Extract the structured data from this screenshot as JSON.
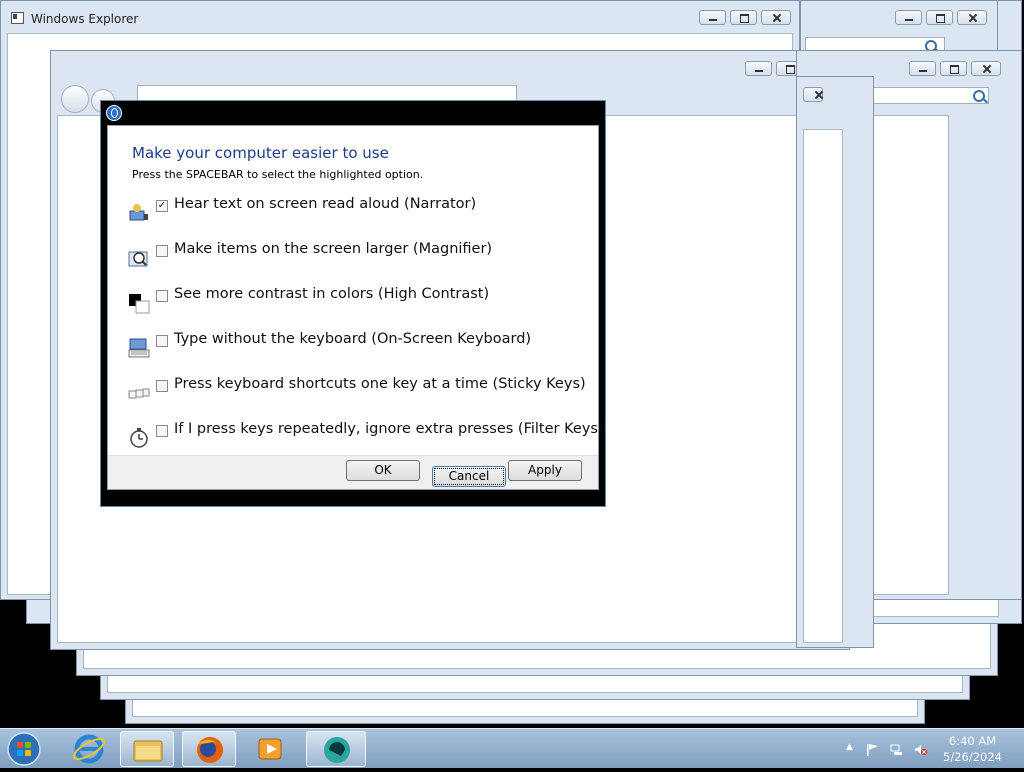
{
  "background_windows": {
    "explorer_title": "Windows Explorer"
  },
  "dialog": {
    "heading": "Make your computer easier to use",
    "instruction": "Press the SPACEBAR to select the highlighted option.",
    "options": [
      {
        "label": "Hear text on screen read aloud (Narrator)",
        "checked": true,
        "icon": "narrator-icon"
      },
      {
        "label": "Make items on the screen larger (Magnifier)",
        "checked": false,
        "icon": "magnifier-icon"
      },
      {
        "label": "See more contrast in colors (High Contrast)",
        "checked": false,
        "icon": "high-contrast-icon"
      },
      {
        "label": "Type without the keyboard (On-Screen Keyboard)",
        "checked": false,
        "icon": "on-screen-keyboard-icon"
      },
      {
        "label": "Press keyboard shortcuts one key at a time (Sticky Keys)",
        "checked": false,
        "icon": "sticky-keys-icon"
      },
      {
        "label": "If I press keys repeatedly, ignore extra presses (Filter Keys)",
        "checked": false,
        "icon": "filter-keys-icon"
      }
    ],
    "buttons": {
      "ok": "OK",
      "cancel": "Cancel",
      "apply": "Apply"
    }
  },
  "taskbar": {
    "items": [
      "start-button",
      "internet-explorer-icon",
      "file-explorer-icon",
      "firefox-icon",
      "media-player-icon",
      "app-icon"
    ],
    "active_item": "app-icon",
    "time": "6:40 AM",
    "date": "5/26/2024"
  },
  "colors": {
    "heading": "#1e3a8a",
    "taskbar": "#8fb0d0",
    "close_red": "#c8402a"
  }
}
